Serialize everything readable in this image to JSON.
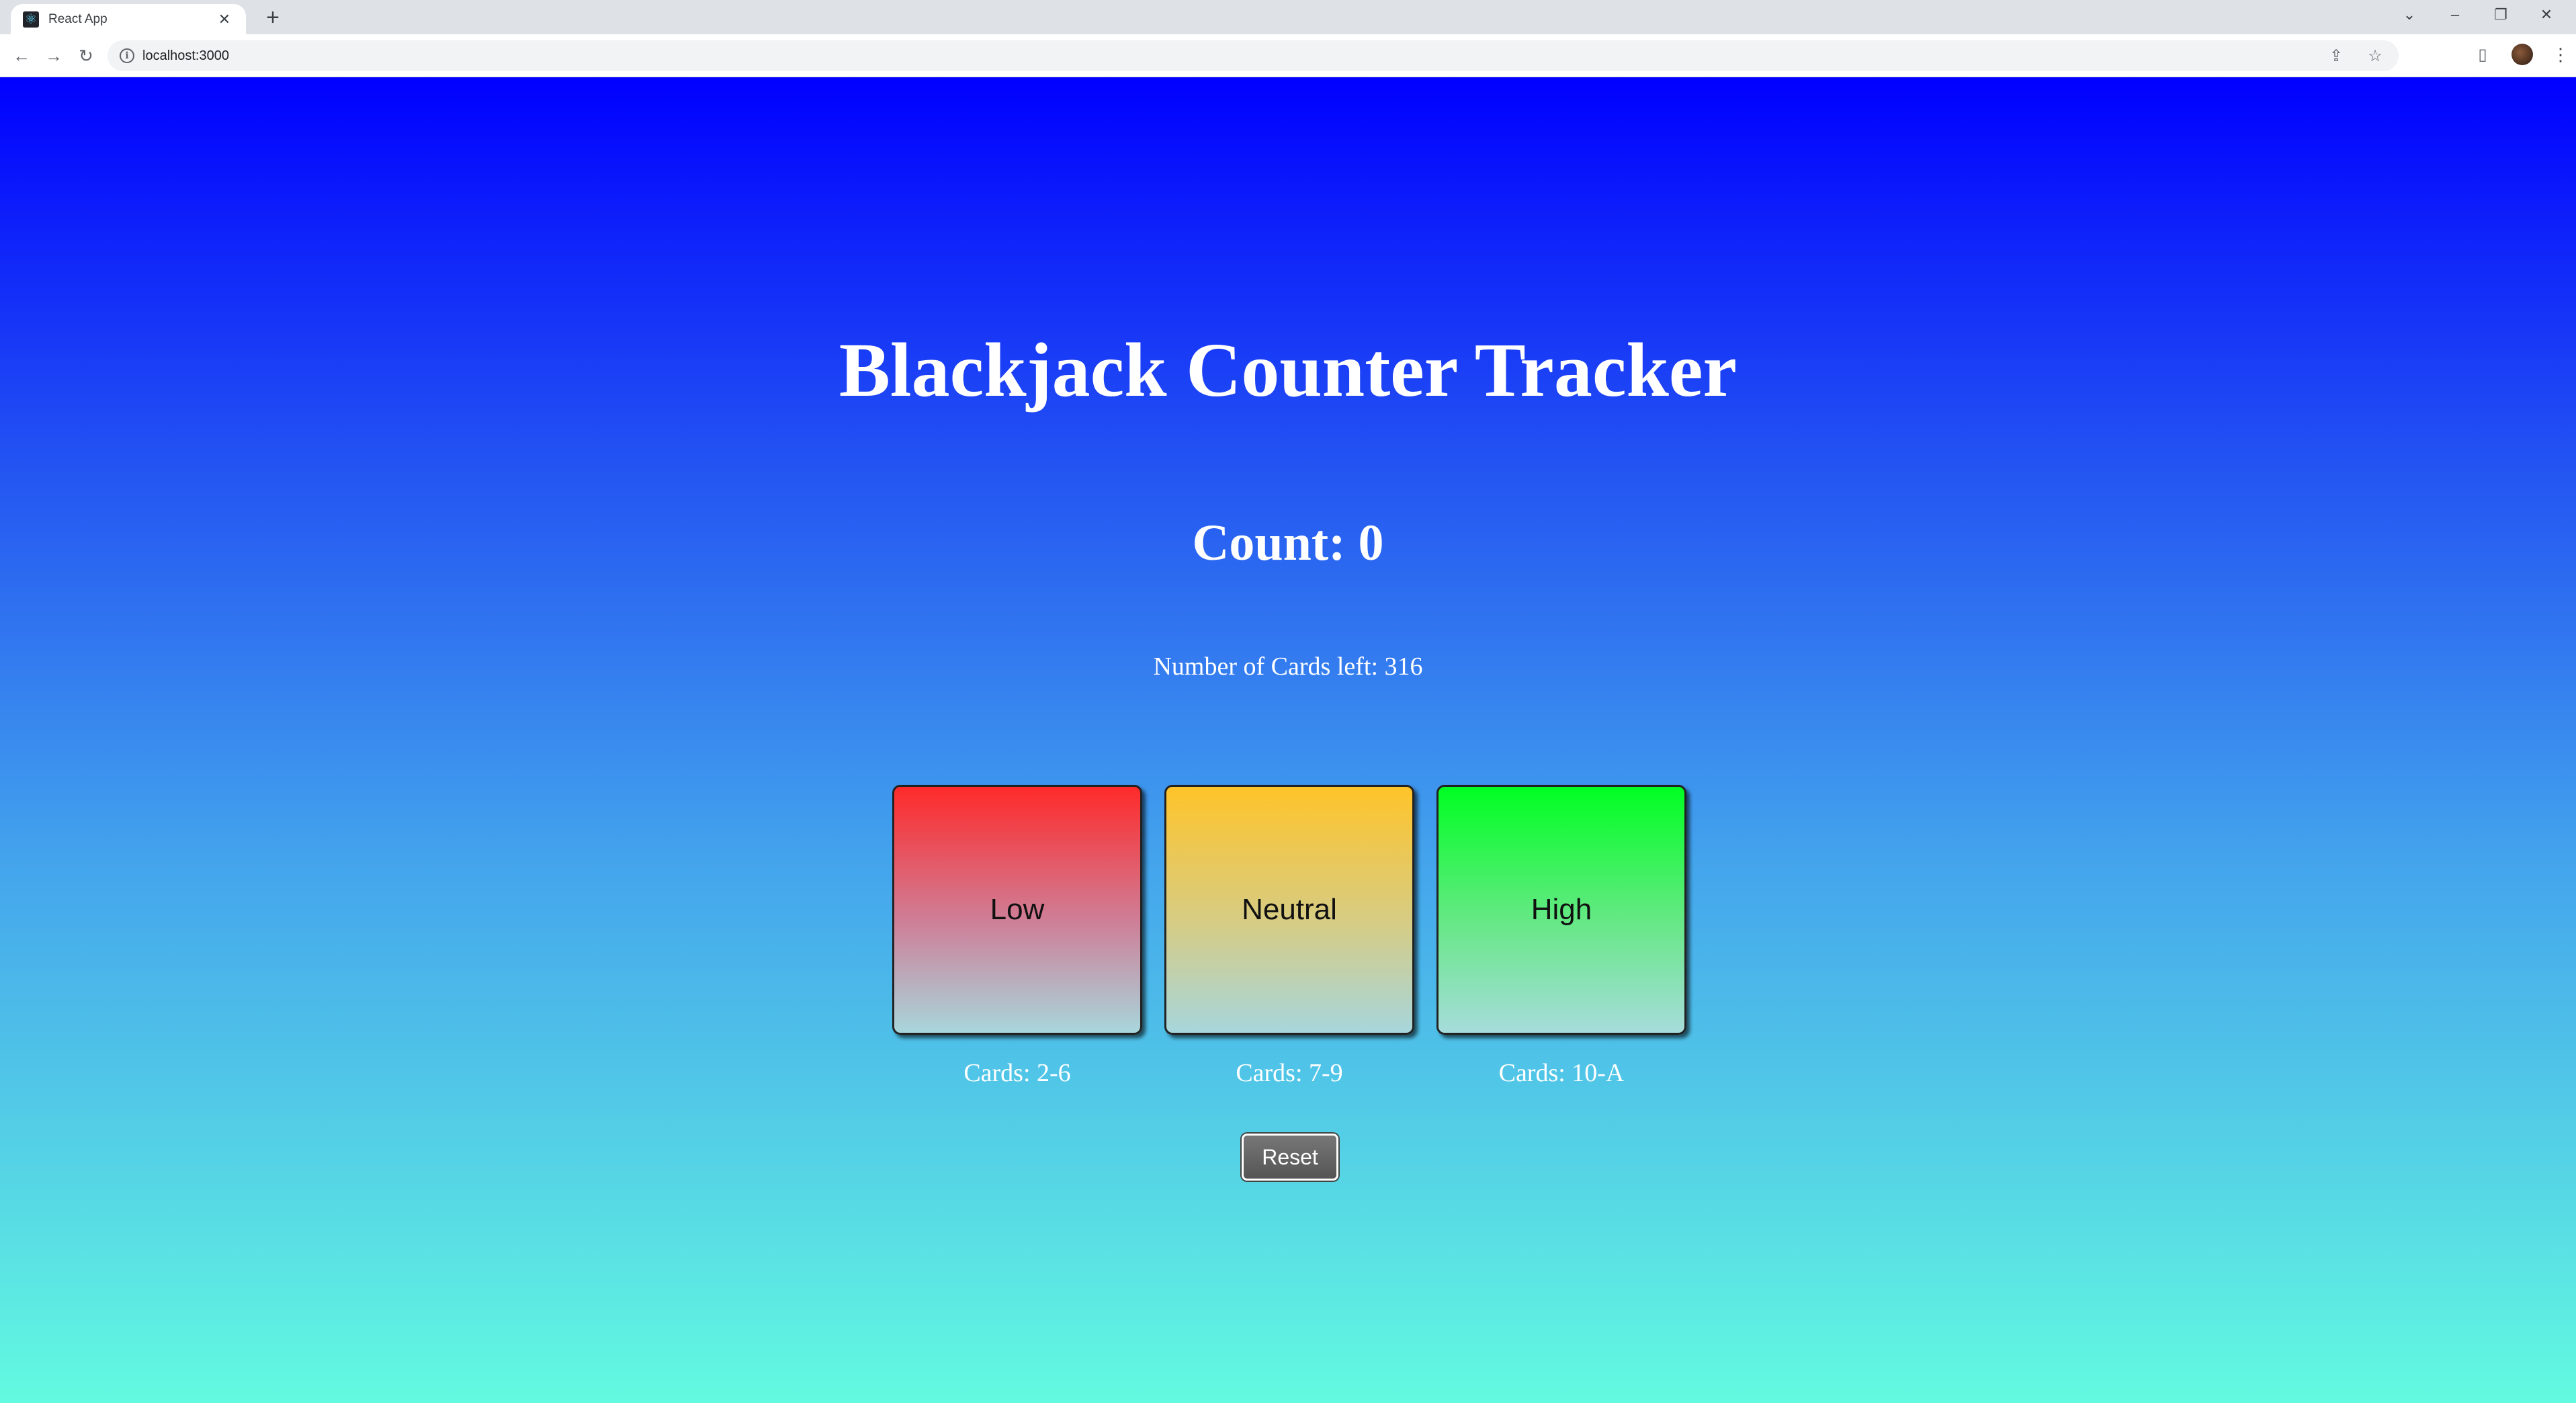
{
  "browser": {
    "tab_title": "React App",
    "tab_close": "✕",
    "new_tab": "+",
    "url": "localhost:3000",
    "controls": {
      "dropdown": "⌄",
      "minimize": "–",
      "restore": "❐",
      "close": "✕"
    },
    "nav": {
      "back": "←",
      "forward": "→",
      "reload": "↻"
    },
    "icons": {
      "info": "i",
      "share": "⇪",
      "star": "☆",
      "sidepanel": "▯",
      "menu": "⋮"
    }
  },
  "app": {
    "title": "Blackjack Counter Tracker",
    "count_text": "Count: 0",
    "cards_left_text": "Number of Cards left: 316",
    "buttons": {
      "low": "Low",
      "neutral": "Neutral",
      "high": "High",
      "reset": "Reset"
    },
    "captions": {
      "low": "Cards: 2-6",
      "neutral": "Cards: 7-9",
      "high": "Cards: 10-A"
    },
    "colors": {
      "background_top": "#0000ff",
      "background_bottom": "#62fae0",
      "low": "#ff2a2a",
      "neutral": "#ffc42a",
      "high": "#00ff22",
      "reset": "#666666"
    }
  }
}
